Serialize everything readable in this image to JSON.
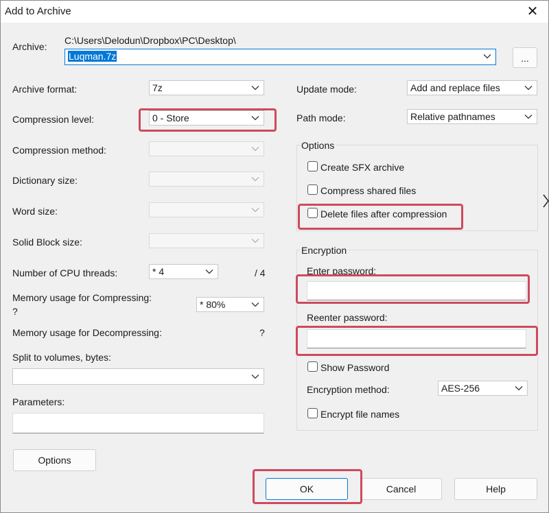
{
  "window": {
    "title": "Add to Archive",
    "close_glyph": "✕"
  },
  "archive": {
    "label": "Archive:",
    "path": "C:\\Users\\Delodun\\Dropbox\\PC\\Desktop\\",
    "name": "Luqman.7z",
    "browse_label": "..."
  },
  "left": {
    "format_label": "Archive format:",
    "format_value": "7z",
    "level_label": "Compression level:",
    "level_value": "0 - Store",
    "method_label": "Compression method:",
    "dict_label": "Dictionary size:",
    "word_label": "Word size:",
    "solid_label": "Solid Block size:",
    "threads_label": "Number of CPU threads:",
    "threads_value": "* 4",
    "threads_max": "/ 4",
    "mem_comp_label": "Memory usage for Compressing:",
    "mem_comp_q": "?",
    "mem_comp_value": "* 80%",
    "mem_decomp_label": "Memory usage for Decompressing:",
    "mem_decomp_q": "?",
    "split_label": "Split to volumes, bytes:",
    "params_label": "Parameters:",
    "options_button": "Options"
  },
  "right": {
    "update_label": "Update mode:",
    "update_value": "Add and replace files",
    "path_label": "Path mode:",
    "path_value": "Relative pathnames",
    "options_group": "Options",
    "opt_sfx": "Create SFX archive",
    "opt_shared": "Compress shared files",
    "opt_delete": "Delete files after compression",
    "enc_group": "Encryption",
    "enter_pw_label": "Enter password:",
    "reenter_pw_label": "Reenter password:",
    "show_pw_label": "Show Password",
    "enc_method_label": "Encryption method:",
    "enc_method_value": "AES-256",
    "encrypt_names_label": "Encrypt file names"
  },
  "buttons": {
    "ok": "OK",
    "cancel": "Cancel",
    "help": "Help"
  },
  "colors": {
    "highlight": "#cd4a5e",
    "selection": "#0078d7"
  }
}
